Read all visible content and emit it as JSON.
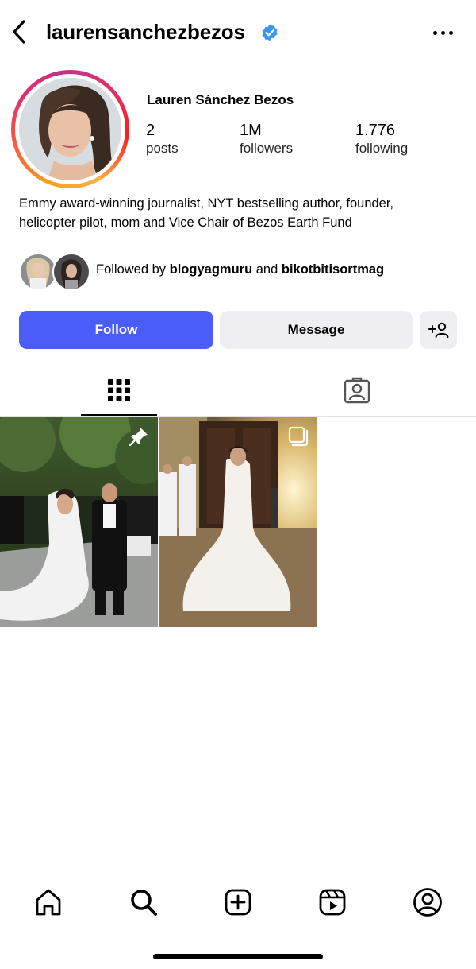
{
  "header": {
    "username": "laurensanchezbezos",
    "verified_icon": "verified-badge-icon",
    "verified_color": "#3897f0",
    "back_icon": "chevron-left-icon",
    "more_icon": "more-horizontal-icon"
  },
  "profile": {
    "display_name": "Lauren Sánchez Bezos",
    "stats": [
      {
        "value": "2",
        "label": "posts"
      },
      {
        "value": "1M",
        "label": "followers"
      },
      {
        "value": "1.776",
        "label": "following"
      }
    ],
    "bio_line1": "Emmy award-winning journalist, NYT bestselling author, founder,",
    "bio_line2": "helicopter pilot, mom and Vice Chair of Bezos Earth Fund",
    "followed_by": {
      "prefix": "Followed by",
      "user1": "blogyagmuru",
      "conjunction": "and",
      "user2": "bikotbitisortmag"
    }
  },
  "actions": {
    "follow_label": "Follow",
    "message_label": "Message",
    "add_user_icon": "add-person-icon",
    "follow_color": "#4a5df9"
  },
  "tabs": [
    {
      "icon": "grid-icon",
      "active": true
    },
    {
      "icon": "tagged-icon",
      "active": false
    }
  ],
  "posts": [
    {
      "badge_icon": "pin-icon"
    },
    {
      "badge_icon": "carousel-icon"
    }
  ],
  "bottom_nav": [
    {
      "icon": "home-icon"
    },
    {
      "icon": "search-icon"
    },
    {
      "icon": "create-icon"
    },
    {
      "icon": "reels-icon"
    },
    {
      "icon": "profile-icon"
    }
  ]
}
